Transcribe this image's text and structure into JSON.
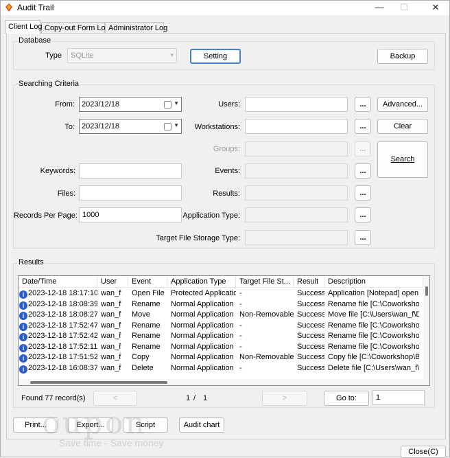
{
  "window": {
    "title": "Audit Trail",
    "controls": {
      "minimize": "—",
      "maximize": "☐",
      "close": "✕"
    }
  },
  "tabs": [
    "Client Log",
    "Copy-out Form Log",
    "Administrator Log"
  ],
  "database": {
    "group_label": "Database",
    "type_label": "Type",
    "type_value": "SQLite",
    "setting_button": "Setting",
    "backup_button": "Backup"
  },
  "criteria": {
    "group_label": "Searching Criteria",
    "from_label": "From:",
    "from_value": "2023/12/18",
    "to_label": "To:",
    "to_value": "2023/12/18",
    "keywords_label": "Keywords:",
    "files_label": "Files:",
    "records_per_page_label": "Records Per Page:",
    "records_per_page_value": "1000",
    "users_label": "Users:",
    "workstations_label": "Workstations:",
    "groups_label": "Groups:",
    "events_label": "Events:",
    "results_label": "Results:",
    "application_type_label": "Application Type:",
    "target_file_storage_type_label": "Target File Storage Type:",
    "ellipsis": "...",
    "advanced_button": "Advanced...",
    "clear_button": "Clear",
    "search_button": "Search"
  },
  "results": {
    "group_label": "Results",
    "columns": [
      "Date/Time",
      "User",
      "Event",
      "Application Type",
      "Target File St...",
      "Result",
      "Description"
    ],
    "rows": [
      [
        "2023-12-18 18:17:10",
        "wan_f",
        "Open File",
        "Protected Application",
        "-",
        "Success",
        "Application [Notepad] open fil"
      ],
      [
        "2023-12-18 18:08:39",
        "wan_f",
        "Rename",
        "Normal Application",
        "-",
        "Success",
        "Rename file [C:\\Coworkshop\\"
      ],
      [
        "2023-12-18 18:08:27",
        "wan_f",
        "Move",
        "Normal Application",
        "Non-Removable ...",
        "Success",
        "Move file [C:\\Users\\wan_f\\Do"
      ],
      [
        "2023-12-18 17:52:47",
        "wan_f",
        "Rename",
        "Normal Application",
        "-",
        "Success",
        "Rename file [C:\\Coworkshop\\"
      ],
      [
        "2023-12-18 17:52:42",
        "wan_f",
        "Rename",
        "Normal Application",
        "-",
        "Success",
        "Rename file [C:\\Coworkshop\\"
      ],
      [
        "2023-12-18 17:52:11",
        "wan_f",
        "Rename",
        "Normal Application",
        "-",
        "Success",
        "Rename file [C:\\Coworkshop\\"
      ],
      [
        "2023-12-18 17:51:52",
        "wan_f",
        "Copy",
        "Normal Application",
        "Non-Removable ...",
        "Success",
        "Copy file [C:\\Coworkshop\\BUS"
      ],
      [
        "2023-12-18 16:08:37",
        "wan_f",
        "Delete",
        "Normal Application",
        "-",
        "Success",
        "Delete file [C:\\Users\\wan_f\\O"
      ]
    ],
    "found_text": "Found 77 record(s)",
    "prev_label": "<",
    "page_current": "1",
    "page_sep": "/",
    "page_total": "1",
    "next_label": ">",
    "goto_label": "Go to:",
    "goto_value": "1"
  },
  "footer": {
    "print_button": "Print...",
    "export_button": "Export...",
    "script_button": "Script",
    "audit_chart_button": "Audit chart",
    "close_button": "Close(C)"
  },
  "watermark": {
    "brand": "oupon",
    "slogan": "Save time - Save money"
  }
}
